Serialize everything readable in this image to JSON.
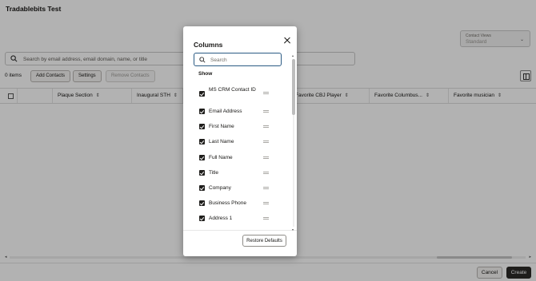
{
  "page": {
    "title": "Tradablebits Test",
    "contact_views": {
      "label": "Contact Views",
      "value": "Standard"
    },
    "search": {
      "placeholder": "Search by email address, email domain, name, or title"
    },
    "toolbar": {
      "items_count": "0 items",
      "add_contacts": "Add Contacts",
      "settings": "Settings",
      "remove_contacts": "Remove Contacts"
    },
    "grid_columns": [
      "Plaque Section",
      "Inaugural STH",
      "Favorite CBJ Player",
      "Favorite Columbus...",
      "Favorite musician"
    ],
    "footer": {
      "cancel": "Cancel",
      "create": "Create"
    }
  },
  "dialog": {
    "title": "Columns",
    "search_placeholder": "Search",
    "section_label": "Show",
    "items": [
      {
        "label": "MS CRM Contact ID",
        "checked": true
      },
      {
        "label": "Email Address",
        "checked": true
      },
      {
        "label": "First Name",
        "checked": true
      },
      {
        "label": "Last Name",
        "checked": true
      },
      {
        "label": "Full Name",
        "checked": true
      },
      {
        "label": "Title",
        "checked": true
      },
      {
        "label": "Company",
        "checked": true
      },
      {
        "label": "Business Phone",
        "checked": true
      },
      {
        "label": "Address 1",
        "checked": true
      }
    ],
    "restore_defaults": "Restore Defaults"
  },
  "icons": {
    "close": "close-icon",
    "search": "search-icon",
    "drag": "drag-handle-icon",
    "sort": "sort-icon",
    "columns": "columns-icon"
  }
}
